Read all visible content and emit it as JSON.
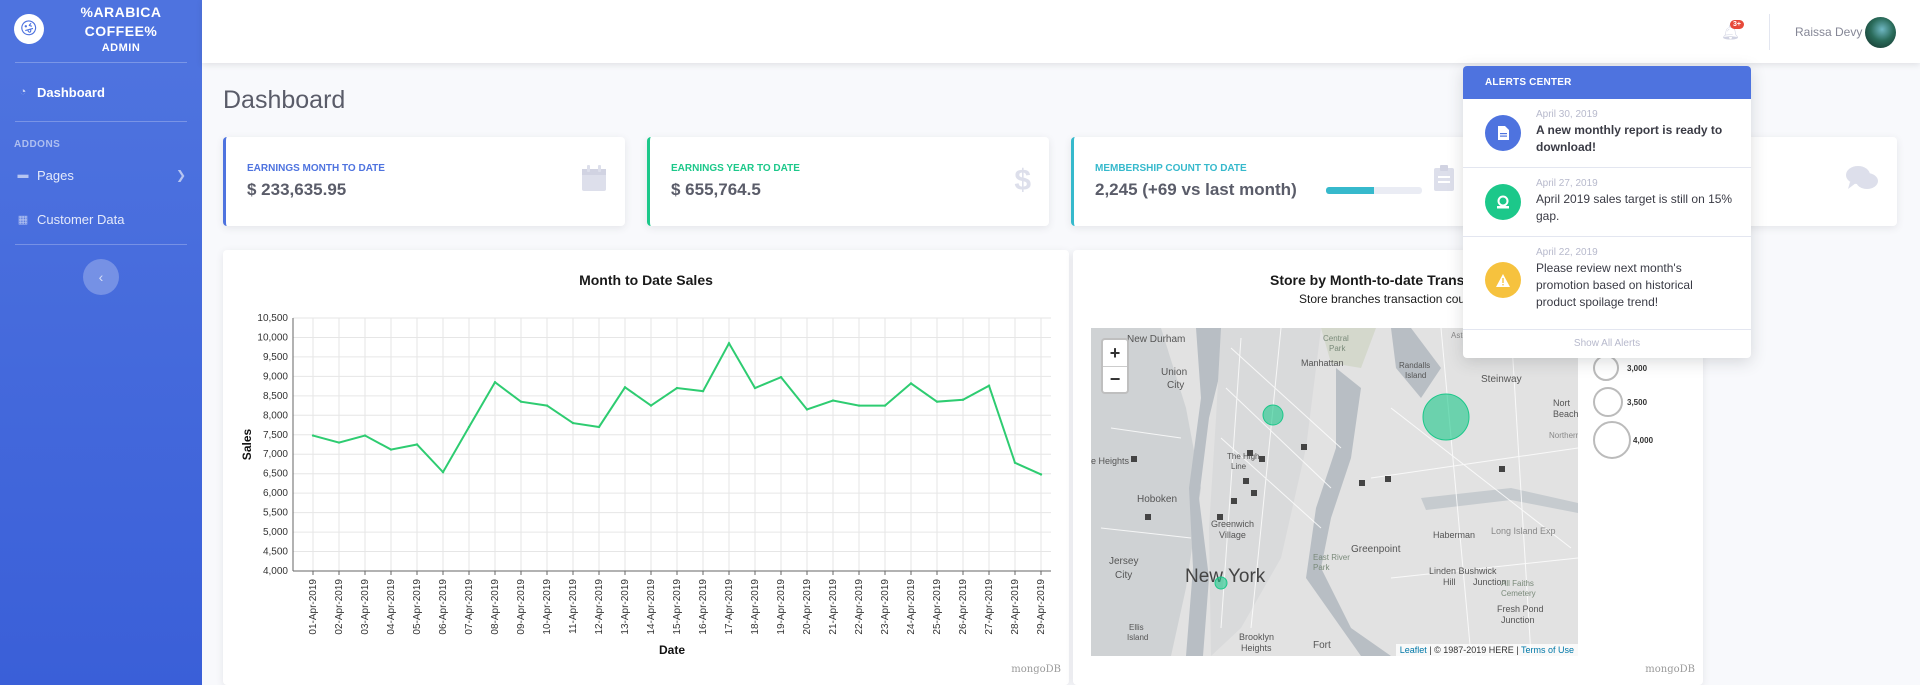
{
  "sidebar": {
    "brand_line1": "%ARABICA",
    "brand_line2": "COFFEE%",
    "brand_sub": "ADMIN",
    "logo_glyph": "😜",
    "items": [
      {
        "label": "Dashboard",
        "icon": "tachometer-icon"
      },
      {
        "label": "Pages",
        "icon": "folder-icon"
      },
      {
        "label": "Customer Data",
        "icon": "table-icon"
      }
    ],
    "heading_addons": "ADDONS",
    "toggle_glyph": "‹"
  },
  "topbar": {
    "alerts_badge": "3+",
    "user_name": "Raissa Devy"
  },
  "page_title": "Dashboard",
  "cards": [
    {
      "label": "EARNINGS MONTH TO DATE",
      "value": "$ 233,635.95",
      "icon": "calendar-icon",
      "color": "#4e73df"
    },
    {
      "label": "EARNINGS YEAR TO DATE",
      "value": "$ 655,764.5",
      "icon": "dollar-icon",
      "color": "#1cc88a"
    },
    {
      "label": "MEMBERSHIP COUNT TO DATE",
      "value": "2,245 (+69 vs last month)",
      "icon": "clipboard-icon",
      "color": "#36b9cc",
      "progress": 0.5
    },
    {
      "label": "",
      "value": "",
      "icon": "comments-icon",
      "color": "#f6c23e"
    }
  ],
  "sales_chart": {
    "title": "Month to Date Sales",
    "footer": "mongoDB"
  },
  "chart_data": {
    "type": "line",
    "title": "Month to Date Sales",
    "xlabel": "Date",
    "ylabel": "Sales",
    "ylim": [
      4000,
      10500
    ],
    "yticks": [
      "4,000",
      "4,500",
      "5,000",
      "5,500",
      "6,000",
      "6,500",
      "7,000",
      "7,500",
      "8,000",
      "8,500",
      "9,000",
      "9,500",
      "10,000",
      "10,500"
    ],
    "grid": true,
    "color": "#2ecc71",
    "x": [
      "01-Apr-2019",
      "02-Apr-2019",
      "03-Apr-2019",
      "04-Apr-2019",
      "05-Apr-2019",
      "06-Apr-2019",
      "07-Apr-2019",
      "08-Apr-2019",
      "09-Apr-2019",
      "10-Apr-2019",
      "11-Apr-2019",
      "12-Apr-2019",
      "13-Apr-2019",
      "14-Apr-2019",
      "15-Apr-2019",
      "16-Apr-2019",
      "17-Apr-2019",
      "18-Apr-2019",
      "19-Apr-2019",
      "20-Apr-2019",
      "21-Apr-2019",
      "22-Apr-2019",
      "23-Apr-2019",
      "24-Apr-2019",
      "25-Apr-2019",
      "26-Apr-2019",
      "27-Apr-2019",
      "28-Apr-2019",
      "29-Apr-2019"
    ],
    "values": [
      7480,
      7300,
      7480,
      7120,
      7250,
      6540,
      7700,
      8850,
      8350,
      8250,
      7800,
      7700,
      8720,
      8250,
      8700,
      8620,
      9850,
      8700,
      8980,
      8150,
      8380,
      8250,
      8250,
      8820,
      8350,
      8400,
      8760,
      6780,
      6480
    ]
  },
  "map_panel": {
    "title": "Store by Month-to-date Trans",
    "subtitle": "Store branches transaction cou",
    "zoom_in": "+",
    "zoom_out": "−",
    "attribution_leaflet": "Leaflet",
    "attribution_here": " | © 1987-2019 HERE | ",
    "attribution_terms": "Terms of Use",
    "legend": [
      "3,000",
      "3,500",
      "4,000"
    ],
    "place_labels": [
      "New Durham",
      "Union City",
      "Central Park",
      "Manhattan",
      "Randalls Island",
      "Steinway",
      "Astoria",
      "Nort Beach",
      "Northern",
      "Heights",
      "Hoboken",
      "The High Line",
      "Greenwich Village",
      "Jersey City",
      "New York",
      "East River Park",
      "Greenpoint",
      "Haberman",
      "Long Island Exp",
      "Linden Bushwick Junction",
      "All Faiths Cemetery",
      "Fresh Pond Junction",
      "Ellis Island",
      "Brooklyn Heights",
      "Fort"
    ],
    "footer": "mongoDB"
  },
  "alerts": {
    "header": "ALERTS CENTER",
    "items": [
      {
        "date": "April 30, 2019",
        "text": "A new monthly report is ready to download!",
        "icon": "file-icon",
        "color": "#4e73df",
        "bold": true
      },
      {
        "date": "April 27, 2019",
        "text": "April 2019 sales target is still on 15% gap.",
        "icon": "donate-icon",
        "color": "#1cc88a",
        "bold": false
      },
      {
        "date": "April 22, 2019",
        "text": "Please review next month's promotion based on historical product spoilage trend!",
        "icon": "warning-icon",
        "color": "#f6c23e",
        "bold": false
      }
    ],
    "show_all": "Show All Alerts"
  }
}
